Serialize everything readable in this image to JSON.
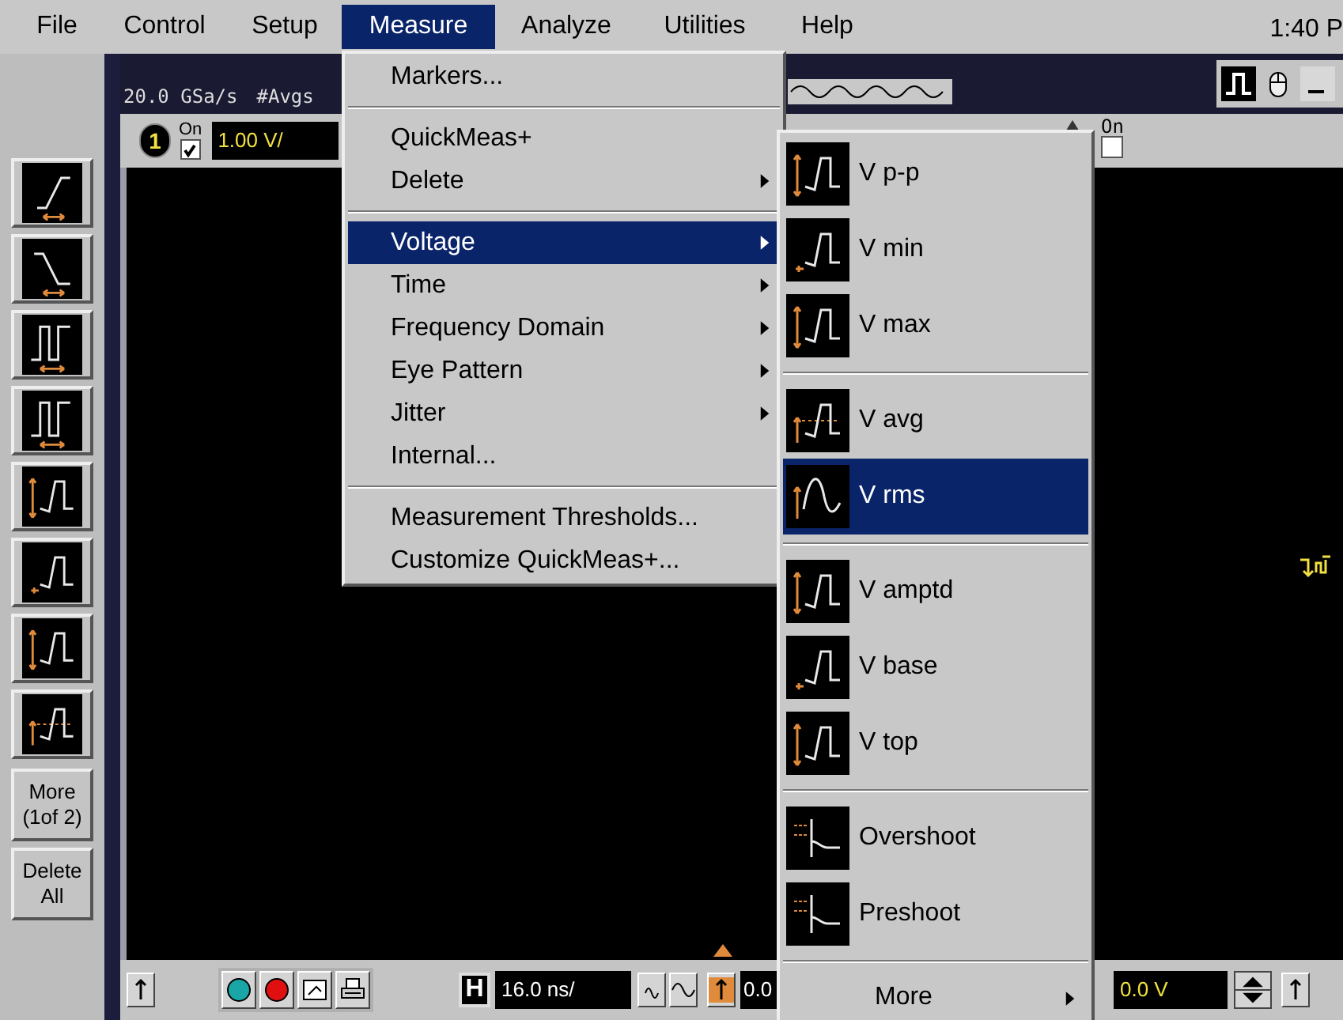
{
  "menu_bar": {
    "items": [
      {
        "label": "File",
        "selected": false
      },
      {
        "label": "Control",
        "selected": false
      },
      {
        "label": "Setup",
        "selected": false
      },
      {
        "label": "Measure",
        "selected": true
      },
      {
        "label": "Analyze",
        "selected": false
      },
      {
        "label": "Utilities",
        "selected": false
      },
      {
        "label": "Help",
        "selected": false
      }
    ],
    "clock": "1:40 P"
  },
  "status_bar": {
    "sample_rate": "20.0 GSa/s",
    "averages": "#Avgs"
  },
  "channel_1": {
    "number": "1",
    "on_label": "On",
    "on": true,
    "scale": "1.00 V/"
  },
  "channel_right": {
    "on_label": "On",
    "on": false
  },
  "left_toolbar": {
    "text_buttons": [
      "More (1of 2)",
      "Delete All"
    ]
  },
  "measure_menu": [
    {
      "kind": "item",
      "label": "Markers...",
      "submenu": false,
      "selected": false
    },
    {
      "kind": "separator"
    },
    {
      "kind": "item",
      "label": "QuickMeas+",
      "submenu": false,
      "selected": false
    },
    {
      "kind": "item",
      "label": "Delete",
      "submenu": true,
      "selected": false
    },
    {
      "kind": "separator"
    },
    {
      "kind": "item",
      "label": "Voltage",
      "submenu": true,
      "selected": true
    },
    {
      "kind": "item",
      "label": "Time",
      "submenu": true,
      "selected": false
    },
    {
      "kind": "item",
      "label": "Frequency Domain",
      "submenu": true,
      "selected": false
    },
    {
      "kind": "item",
      "label": "Eye Pattern",
      "submenu": true,
      "selected": false
    },
    {
      "kind": "item",
      "label": "Jitter",
      "submenu": true,
      "selected": false
    },
    {
      "kind": "item",
      "label": "Internal...",
      "submenu": false,
      "selected": false
    },
    {
      "kind": "separator"
    },
    {
      "kind": "item",
      "label": "Measurement Thresholds...",
      "submenu": false,
      "selected": false
    },
    {
      "kind": "item",
      "label": "Customize QuickMeas+...",
      "submenu": false,
      "selected": false
    }
  ],
  "voltage_submenu": [
    {
      "kind": "measure",
      "label": "V p-p",
      "selected": false
    },
    {
      "kind": "measure",
      "label": "V min",
      "selected": false
    },
    {
      "kind": "measure",
      "label": "V max",
      "selected": false
    },
    {
      "kind": "separator"
    },
    {
      "kind": "measure",
      "label": "V avg",
      "selected": false
    },
    {
      "kind": "measure",
      "label": "V rms",
      "selected": true
    },
    {
      "kind": "separator"
    },
    {
      "kind": "measure",
      "label": "V amptd",
      "selected": false
    },
    {
      "kind": "measure",
      "label": "V base",
      "selected": false
    },
    {
      "kind": "measure",
      "label": "V top",
      "selected": false
    },
    {
      "kind": "separator"
    },
    {
      "kind": "measure",
      "label": "Overshoot",
      "selected": false
    },
    {
      "kind": "measure",
      "label": "Preshoot",
      "selected": false
    },
    {
      "kind": "separator"
    },
    {
      "kind": "more",
      "label": "More",
      "submenu": true,
      "selected": false
    }
  ],
  "bottom_bar": {
    "timebase_label": "H",
    "timebase": "16.0 ns/",
    "delay": "0.0",
    "offset": "0.0 V"
  }
}
